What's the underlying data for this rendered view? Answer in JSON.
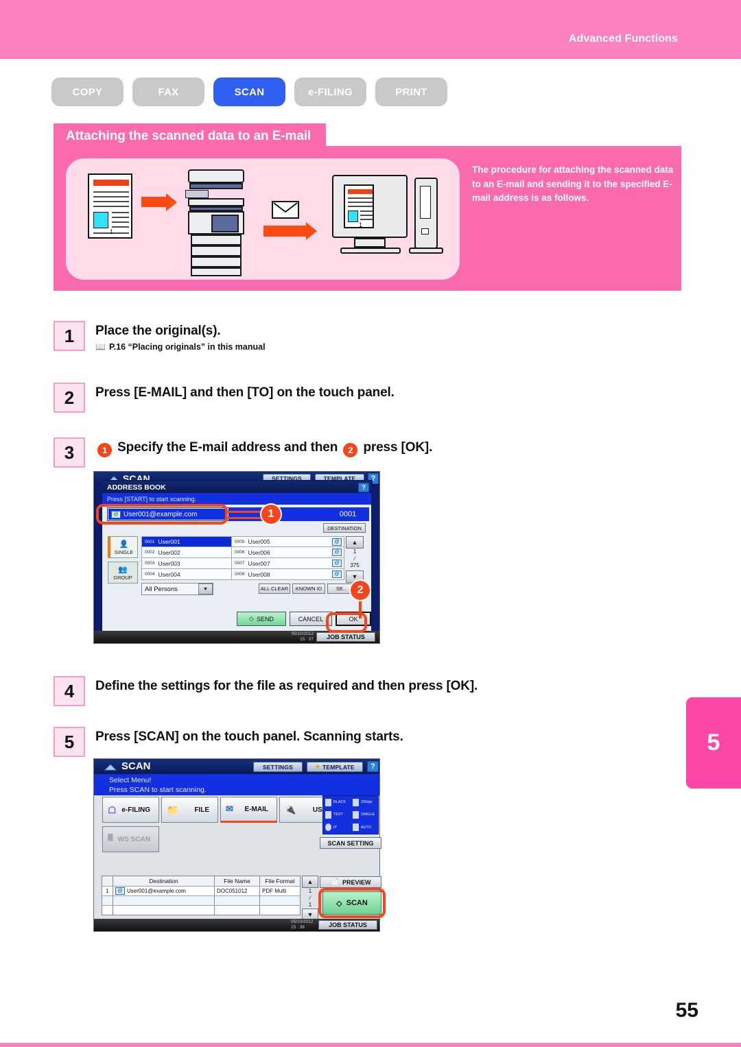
{
  "header": {
    "section_label": "Advanced Functions"
  },
  "tabs": [
    {
      "label": "COPY",
      "active": false
    },
    {
      "label": "FAX",
      "active": false
    },
    {
      "label": "SCAN",
      "active": true
    },
    {
      "label": "e-FILING",
      "active": false
    },
    {
      "label": "PRINT",
      "active": false
    }
  ],
  "title_bar": {
    "text": "Attaching the scanned data to an E-mail"
  },
  "intro": {
    "text": "The procedure for attaching the scanned data to an E-mail and sending it to the specified E-mail address is as follows.",
    "illustration": {
      "page_number_label": "1"
    }
  },
  "steps": [
    {
      "num": "1",
      "title": "Place the original(s).",
      "reference": "P.16 “Placing originals” in this manual"
    },
    {
      "num": "2",
      "title": "Press [E-MAIL] and then [TO] on the touch panel."
    },
    {
      "num": "3",
      "title_pre": "Specify the E-mail address and then",
      "title_post": "press [OK].",
      "callout_a": "1",
      "callout_b": "2"
    },
    {
      "num": "4",
      "title": "Define the settings for the file as required and then press [OK]."
    },
    {
      "num": "5",
      "title": "Press [SCAN] on the touch panel. Scanning starts."
    }
  ],
  "panel3": {
    "app_title": "SCAN",
    "settings_btn": "SETTINGS",
    "template_btn": "TEMPLATE",
    "help_btn": "?",
    "dialog_title": "ADDRESS BOOK",
    "status_msg": "Press [START] to start scanning.",
    "address_value": "User001@example.com",
    "address_count": "0001",
    "destination_btn": "DESTINATION",
    "side_tabs": [
      {
        "label": "SINGLE",
        "selected": true
      },
      {
        "label": "GROUP",
        "selected": false
      }
    ],
    "contacts_left": [
      {
        "id": "0001",
        "name": "User001",
        "selected": true
      },
      {
        "id": "0002",
        "name": "User002",
        "selected": false
      },
      {
        "id": "0003",
        "name": "User003",
        "selected": false
      },
      {
        "id": "0004",
        "name": "User004",
        "selected": false
      }
    ],
    "contacts_right": [
      {
        "id": "0005",
        "name": "User005",
        "selected": false
      },
      {
        "id": "0006",
        "name": "User006",
        "selected": false
      },
      {
        "id": "0007",
        "name": "User007",
        "selected": false
      },
      {
        "id": "0008",
        "name": "User008",
        "selected": false
      }
    ],
    "page_current": "1",
    "page_total": "375",
    "filter_value": "All Persons",
    "all_clear_btn": "ALL CLEAR",
    "known_id_btn": "KNOWN ID",
    "search_btn": "SE..",
    "send_btn": "SEND",
    "cancel_btn": "CANCEL",
    "ok_btn": "OK",
    "date": "05/10/2012",
    "time": "15 : 37",
    "job_status_btn": "JOB STATUS"
  },
  "panel5": {
    "app_title": "SCAN",
    "settings_btn": "SETTINGS",
    "template_btn": "TEMPLATE",
    "help_btn": "?",
    "message_line1": "Select Menu!",
    "message_line2": "Press SCAN to start scanning.",
    "menu_buttons": [
      {
        "label": "e-FILING",
        "disabled": false
      },
      {
        "label": "FILE",
        "disabled": false
      },
      {
        "label": "E-MAIL",
        "disabled": false,
        "highlighted": true
      },
      {
        "label": "USB",
        "disabled": false
      },
      {
        "label": "WS SCAN",
        "disabled": true
      }
    ],
    "scan_settings": [
      {
        "label": "BLACK"
      },
      {
        "label": "200dpi"
      },
      {
        "label": "TEXT"
      },
      {
        "label": "SINGLE"
      },
      {
        "label": "0°"
      },
      {
        "label": "AUTO"
      }
    ],
    "scan_setting_btn": "SCAN SETTING",
    "table": {
      "headers": [
        "",
        "Destination",
        "File Name",
        "File Format"
      ],
      "rows": [
        {
          "index": "1",
          "destination": "User001@example.com",
          "file_name": "DOC051012",
          "file_format": "PDF Multi"
        },
        {
          "index": "",
          "destination": "",
          "file_name": "",
          "file_format": ""
        },
        {
          "index": "",
          "destination": "",
          "file_name": "",
          "file_format": ""
        }
      ]
    },
    "page_current": "1",
    "page_total": "1",
    "preview_btn": "PREVIEW",
    "scan_btn": "SCAN",
    "date": "05/10/2012",
    "time": "15 : 38",
    "job_status_btn": "JOB STATUS"
  },
  "side_tab": {
    "label": "5"
  },
  "page_number": "55",
  "colors": {
    "header_pink": "#fd80c0",
    "accent_pink": "#fc6aae",
    "tab_active_blue": "#2f60f2",
    "tab_inactive_grey": "#c9c9c9",
    "callout_orange": "#f7451b",
    "side_tab_pink": "#fc47a6"
  }
}
